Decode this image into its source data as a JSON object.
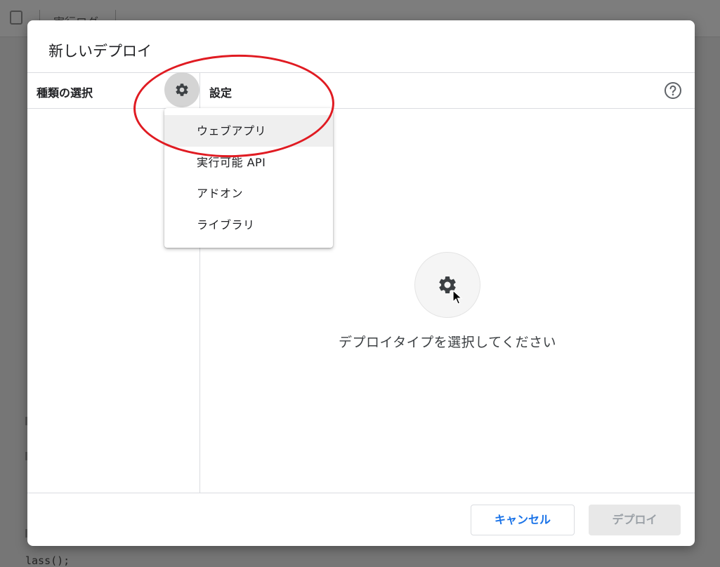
{
  "background": {
    "toolbar_tab": "実行ログ",
    "code_snippet": "lass();"
  },
  "dialog": {
    "title": "新しいデプロイ",
    "type_panel_label": "種類の選択",
    "settings_panel_label": "設定",
    "empty_state_text": "デプロイタイプを選択してください",
    "cancel_label": "キャンセル",
    "deploy_label": "デプロイ"
  },
  "menu": {
    "items": [
      {
        "label": "ウェブアプリ"
      },
      {
        "label": "実行可能 API"
      },
      {
        "label": "アドオン"
      },
      {
        "label": "ライブラリ"
      }
    ],
    "selected_index": 0
  },
  "icons": {
    "type_selector": "gear-icon",
    "help": "help-circle-icon",
    "empty_state": "gear-icon",
    "save": "save-icon"
  },
  "colors": {
    "annotation": "#e01b22",
    "primary": "#1a73e8",
    "disabled_text": "#9aa0a6"
  }
}
